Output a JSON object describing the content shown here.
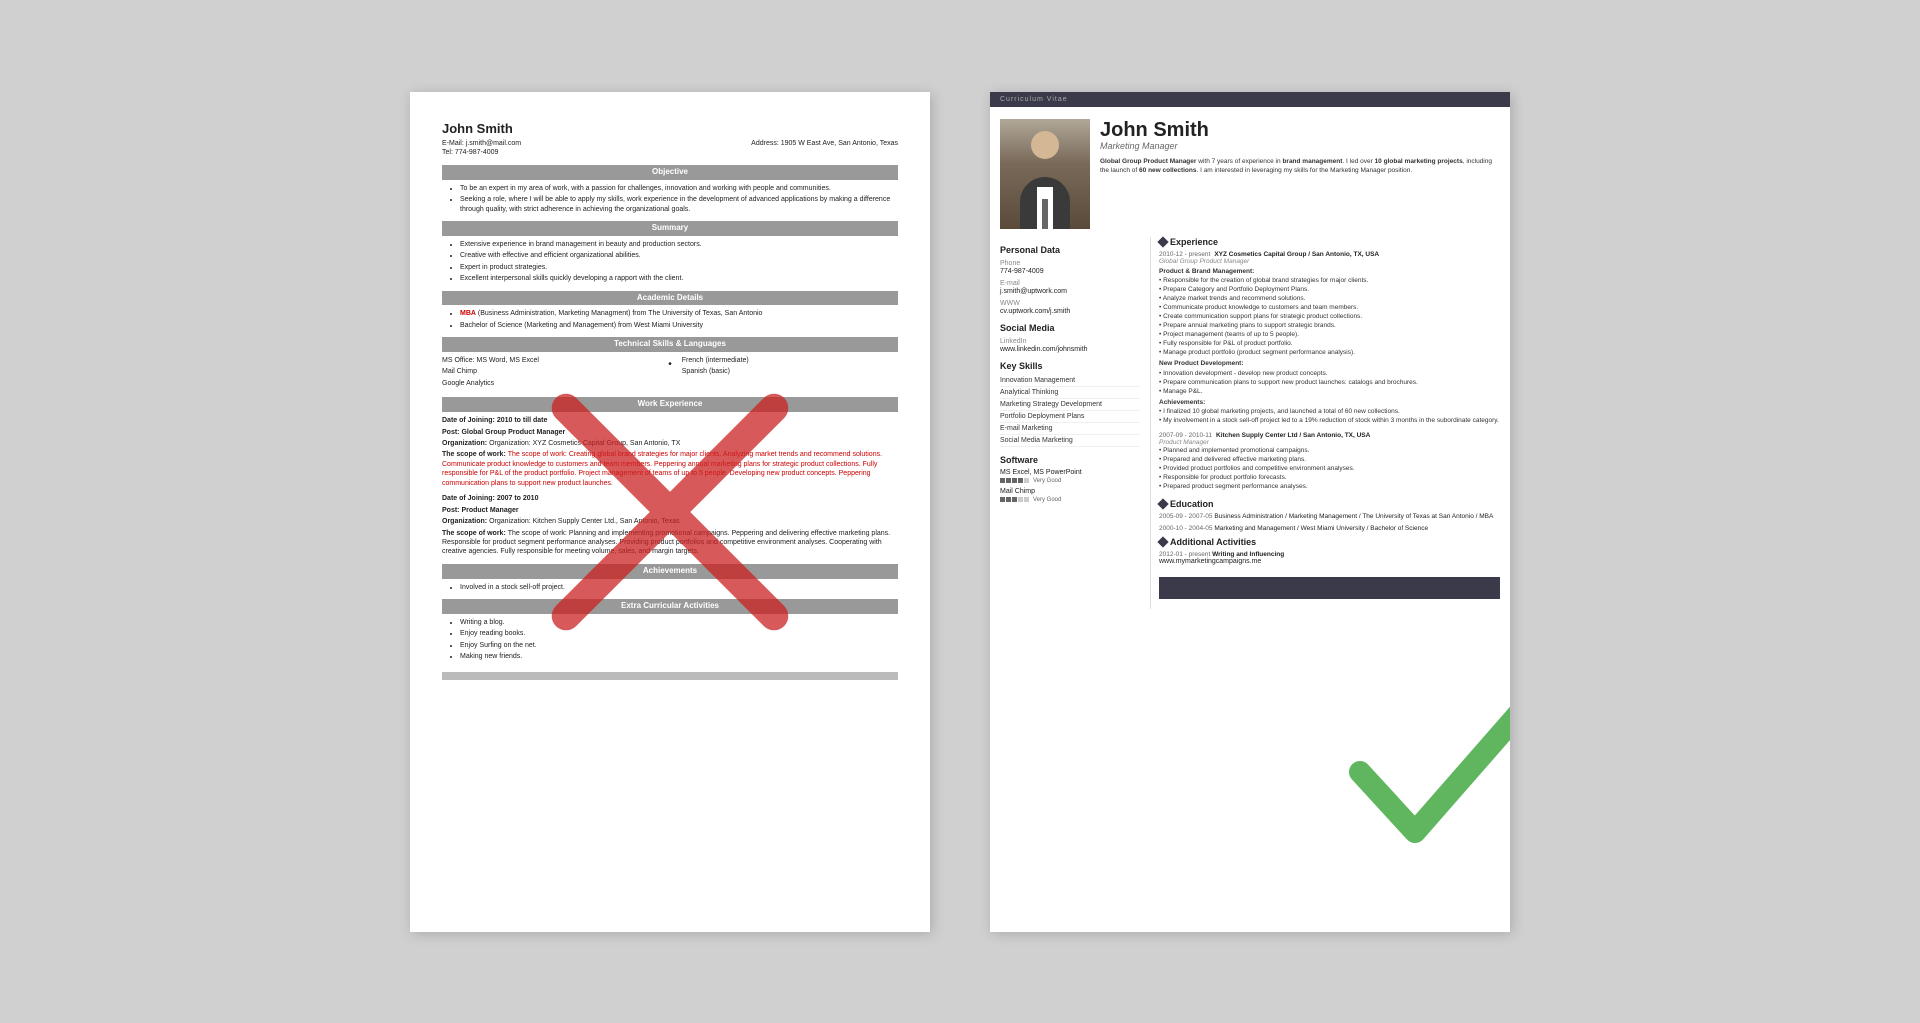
{
  "page": {
    "background": "#d0d0d0"
  },
  "left_resume": {
    "name": "John Smith",
    "email_label": "E-Mail:",
    "email": "j.smith@mail.com",
    "address_label": "Address:",
    "address": "1905 W East Ave, San Antonio, Texas",
    "tel_label": "Tel:",
    "tel": "774-987-4009",
    "sections": {
      "objective": {
        "header": "Objective",
        "bullets": [
          "To be an expert in my area of work, with a passion for challenges, innovation and working with people and communities.",
          "Seeking a role, where I will be able to apply my skills, work experience in the development of advanced applications by making a difference through quality, with strict adherence in achieving the organizational goals."
        ]
      },
      "summary": {
        "header": "Summary",
        "bullets": [
          "Extensive experience in brand management in beauty and production sectors.",
          "Creative with effective and efficient organizational abilities.",
          "Expert in product strategies.",
          "Excellent interpersonal skills quickly developing a rapport with the client."
        ]
      },
      "academic": {
        "header": "Academic Details",
        "items": [
          "MBA (Business Administration, Marketing Managment) from The University of Texas, San Antonio",
          "Bachelor of Science (Marketing and Management) from West Miami University"
        ]
      },
      "technical": {
        "header": "Technical Skills & Languages",
        "left": [
          "MS Office: MS Word, MS Excel",
          "Mail Chimp",
          "Google Analytics"
        ],
        "right": [
          "French (intermediate)",
          "Spanish (basic)"
        ]
      },
      "work": {
        "header": "Work Experience",
        "jobs": [
          {
            "date_joining": "Date of Joining: 2010 to till date",
            "post": "Post: Global Group Product Manager",
            "org": "Organization: XYZ Cosmetics Capital Group, San Antonio, TX",
            "scope": "The scope of work: Creating global brand strategies for major clients. Analyzing market trends and recommend solutions. Communicate product knowledge to customers and team members. Peppering annual marketing plans for strategic product collections. Fully responsible for P&L of the product portfolio. Project management of teams of up to 5 people. Developing new product concepts. Peppering communication plans to support new product launches."
          },
          {
            "date_joining": "Date of Joining: 2007 to 2010",
            "post": "Post: Product Manager",
            "org": "Organization: Kitchen Supply Center Ltd., San Antonio, Texas",
            "scope": "The scope of work: Planning and implementing promotional campaigns. Peppering and delivering effective marketing plans. Responsible for product segment performance analyses. Providing product portfolios and competitive environment analyses. Cooperating with creative agencies. Fully responsible for meeting volume, sales, and margin targets."
          }
        ]
      },
      "achievements": {
        "header": "Achievements",
        "text": "Involved in a stock sell-off project."
      },
      "extra": {
        "header": "Extra Curricular Activities",
        "bullets": [
          "Writing a blog.",
          "Enjoy reading books.",
          "Enjoy Surfing on the net.",
          "Making new friends."
        ]
      }
    }
  },
  "right_resume": {
    "cv_label": "Curriculum Vitae",
    "name": "John Smith",
    "job_title": "Marketing Manager",
    "summary": "Global Group Product Manager with 7 years of experience in brand management. I led over 10 global marketing projects, including the launch of 60 new collections. I am interested in leveraging my skills for the Marketing Manager position.",
    "personal_data": {
      "section": "Personal Data",
      "phone_label": "Phone",
      "phone": "774-987-4009",
      "email_label": "E-mail",
      "email": "j.smith@uptwork.com",
      "www_label": "WWW",
      "www": "cv.uptwork.com/j.smith"
    },
    "social_media": {
      "section": "Social Media",
      "linkedin_label": "LinkedIn",
      "linkedin": "www.linkedin.com/johnsmith"
    },
    "key_skills": {
      "section": "Key Skills",
      "items": [
        "Innovation Management",
        "Analytical Thinking",
        "Marketing Strategy Development",
        "Portfolio Deployment Plans",
        "E-mail Marketing",
        "Social Media Marketing"
      ]
    },
    "software": {
      "section": "Software",
      "items": [
        {
          "name": "MS Excel, MS PowerPoint",
          "level": "Very Good",
          "dots": 4,
          "total": 5
        },
        {
          "name": "Mail Chimp",
          "level": "Very Good",
          "dots": 3,
          "total": 5
        }
      ]
    },
    "experience": {
      "section": "Experience",
      "jobs": [
        {
          "dates": "2010-12 - present",
          "company": "XYZ Cosmetics Capital Group / San Antonio, TX, USA",
          "role": "Global Group Product Manager",
          "subheads": [
            {
              "title": "Product & Brand Management:",
              "bullets": [
                "Responsible for the creation of global brand strategies for major clients.",
                "Prepare Category and Portfolio Deployment Plans.",
                "Analyze market trends and recommend solutions.",
                "Communicate product knowledge to customers and team members.",
                "Create communication support plans for strategic product collections.",
                "Prepare annual marketing plans to support strategic brands.",
                "Project management (teams of up to 5 people).",
                "Fully responsible for P&L of product portfolio.",
                "Manage product portfolio (product segment performance analysis)."
              ]
            },
            {
              "title": "New Product Development:",
              "bullets": [
                "Innovation development - develop new product concepts.",
                "Prepare communication plans to support new product launches: catalogs and brochures.",
                "Manage P&L."
              ]
            },
            {
              "title": "Achievements:",
              "bullets": [
                "I finalized 10 global marketing projects, and launched a total of 60 new collections.",
                "My involvement in a stock sell-off project led to a 19% reduction of stock within 3 months in the subordinate category."
              ]
            }
          ]
        },
        {
          "dates": "2007-09 - 2010-11",
          "company": "Kitchen Supply Center Ltd / San Antonio, TX, USA",
          "role": "Product Manager",
          "bullets": [
            "Planned and implemented promotional campaigns.",
            "Prepared and delivered effective marketing plans.",
            "Provided product portfolios and competitive environment analyses.",
            "Responsible for product portfolio forecasts.",
            "Prepared product segment performance analyses."
          ]
        }
      ]
    },
    "education": {
      "section": "Education",
      "items": [
        {
          "dates": "2005-09 - 2007-05",
          "detail": "Business Administration / Marketing Management / The University of Texas at San Antonio / MBA"
        },
        {
          "dates": "2000-10 - 2004-05",
          "detail": "Marketing and Management / West Miami University / Bachelor of Science"
        }
      ]
    },
    "additional": {
      "section": "Additional Activities",
      "items": [
        {
          "dates": "2012-01 - present",
          "title": "Writing and Influencing",
          "detail": "www.mymarketingcampaigns.me"
        }
      ]
    }
  },
  "icons": {
    "x_color": "#cc2222",
    "check_color": "#44aa44"
  }
}
